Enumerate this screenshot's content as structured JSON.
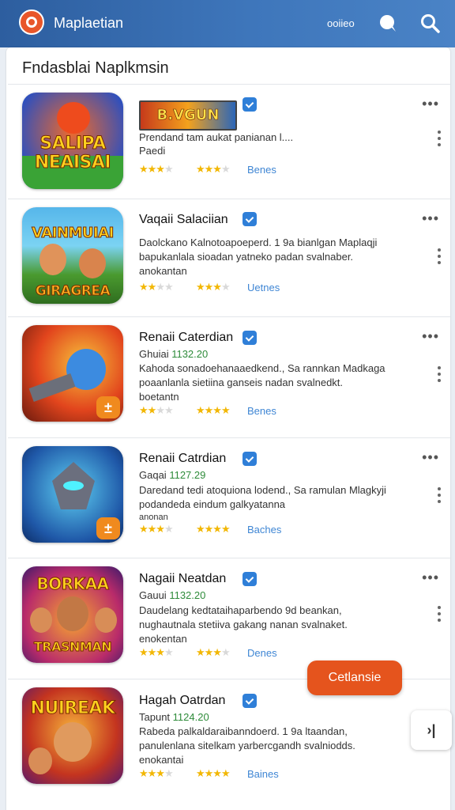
{
  "header": {
    "app_title": "Maplaetian",
    "top_text": "ooiieo",
    "icons": [
      "chat-bubble-icon",
      "search-icon"
    ]
  },
  "section_title": "Fndasblai Naplkmsin",
  "items": [
    {
      "banner_text": "B.VGUN",
      "name": "",
      "meta_label": "",
      "meta_rank": "",
      "desc1": "Prendand tam aukat panianan l....",
      "desc2": "Paedi",
      "desc3": "",
      "stars1": 3,
      "stars2": 3,
      "link": "Benes",
      "thumb_text": [
        "SALIPA",
        "NEAISAI"
      ]
    },
    {
      "name": "Vaqaii Salaciian",
      "meta_label": "",
      "meta_rank": "",
      "desc1": "Daolckano Kalnotoapoeperd. 1 9a bianlgan Maplaqji",
      "desc2": "bapukanlala sioadan yatneko padan svalnaber.",
      "desc3": "anokantan",
      "stars1": 2,
      "stars2": 3,
      "link": "Uetnes",
      "thumb_text": [
        "VAINMUIAI",
        "GIRAGREA"
      ]
    },
    {
      "name": "Renaii Caterdian",
      "meta_label": "Ghuiai",
      "meta_rank": "1132.20",
      "desc1": "Kahoda sonadoehanaaedkend., Sa rannkan Madkaga",
      "desc2": "poaanlanla sietiina ganseis nadan svalnedkt.",
      "desc3": "boetantn",
      "stars1": 2,
      "stars2": 4,
      "link": "Benes",
      "thumb_text": []
    },
    {
      "name": "Renaii Catrdian",
      "meta_label": "Gaqai",
      "meta_rank": "1127.29",
      "desc1": "Daredand tedi atoquiona lodend., Sa ramulan Mlagkyji",
      "desc2": "podandeda eindum galkyatanna",
      "desc3": "anonan",
      "stars1": 3,
      "stars2": 4,
      "link": "Baches",
      "thumb_text": []
    },
    {
      "name": "Nagaii Neatdan",
      "meta_label": "Gauui",
      "meta_rank": "1132.20",
      "desc1": "Daudelang kedtataihaparbendo 9d beankan,",
      "desc2": "nughautnala stetiiva gakang nanan svalnaket.",
      "desc3": "enokentan",
      "stars1": 3,
      "stars2": 3,
      "link": "Denes",
      "thumb_text": [
        "BORKAA",
        "TRASNMAN"
      ]
    },
    {
      "name": "Hagah Oatrdan",
      "meta_label": "Tapunt",
      "meta_rank": "1124.20",
      "desc1": "Rabeda palkaldaraibanndoerd. 1 9a ltaandan,",
      "desc2": "panulenlana sitelkam yarbercgandh svalniodds.",
      "desc3": "enokantai",
      "stars1": 3,
      "stars2": 4,
      "link": "Baines",
      "thumb_text": [
        "NUIREAK"
      ]
    }
  ],
  "fab_label": "Cetlansie",
  "side_button_label": "›|",
  "colors": {
    "appbar": "#3a6fb1",
    "accent_orange": "#e5541d",
    "star": "#f2b705",
    "verify": "#2f7fd8",
    "link": "#3f86d4"
  }
}
